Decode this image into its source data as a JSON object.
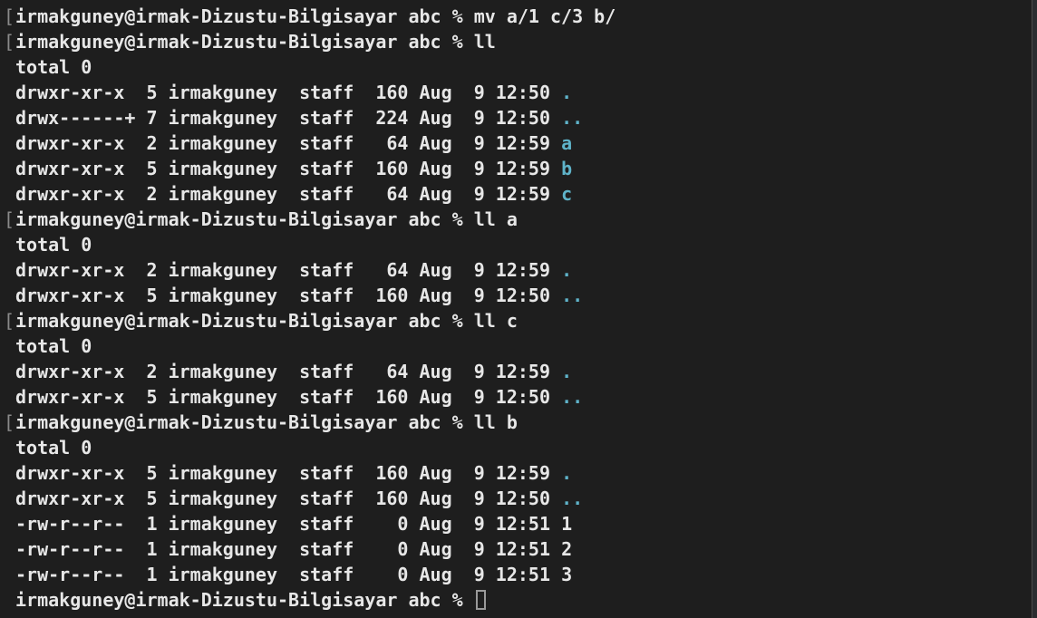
{
  "colors": {
    "background": "#1e1e1e",
    "foreground": "#e7e7e7",
    "directory_name": "#5fb3c9",
    "bracket": "#8a8a8a",
    "cursor": "#9a9a9a"
  },
  "terminal": {
    "lines": [
      {
        "type": "cmd",
        "text": "irmakguney@irmak-Dizustu-Bilgisayar abc % mv a/1 c/3 b/",
        "bracket_left": "[",
        "bracket_right": ""
      },
      {
        "type": "cmd",
        "text": "irmakguney@irmak-Dizustu-Bilgisayar abc % ll",
        "bracket_left": "[",
        "bracket_right": "]"
      },
      {
        "type": "out",
        "text": "total 0"
      },
      {
        "type": "entry",
        "text": "drwxr-xr-x  5 irmakguney  staff  160 Aug  9 12:50 ",
        "name": ".",
        "dir": true
      },
      {
        "type": "entry",
        "text": "drwx------+ 7 irmakguney  staff  224 Aug  9 12:50 ",
        "name": "..",
        "dir": true
      },
      {
        "type": "entry",
        "text": "drwxr-xr-x  2 irmakguney  staff   64 Aug  9 12:59 ",
        "name": "a",
        "dir": true
      },
      {
        "type": "entry",
        "text": "drwxr-xr-x  5 irmakguney  staff  160 Aug  9 12:59 ",
        "name": "b",
        "dir": true
      },
      {
        "type": "entry",
        "text": "drwxr-xr-x  2 irmakguney  staff   64 Aug  9 12:59 ",
        "name": "c",
        "dir": true
      },
      {
        "type": "cmd",
        "text": "irmakguney@irmak-Dizustu-Bilgisayar abc % ll a",
        "bracket_left": "[",
        "bracket_right": "]"
      },
      {
        "type": "out",
        "text": "total 0"
      },
      {
        "type": "entry",
        "text": "drwxr-xr-x  2 irmakguney  staff   64 Aug  9 12:59 ",
        "name": ".",
        "dir": true
      },
      {
        "type": "entry",
        "text": "drwxr-xr-x  5 irmakguney  staff  160 Aug  9 12:50 ",
        "name": "..",
        "dir": true
      },
      {
        "type": "cmd",
        "text": "irmakguney@irmak-Dizustu-Bilgisayar abc % ll c",
        "bracket_left": "[",
        "bracket_right": "]"
      },
      {
        "type": "out",
        "text": "total 0"
      },
      {
        "type": "entry",
        "text": "drwxr-xr-x  2 irmakguney  staff   64 Aug  9 12:59 ",
        "name": ".",
        "dir": true
      },
      {
        "type": "entry",
        "text": "drwxr-xr-x  5 irmakguney  staff  160 Aug  9 12:50 ",
        "name": "..",
        "dir": true
      },
      {
        "type": "cmd",
        "text": "irmakguney@irmak-Dizustu-Bilgisayar abc % ll b",
        "bracket_left": "[",
        "bracket_right": "]"
      },
      {
        "type": "out",
        "text": "total 0"
      },
      {
        "type": "entry",
        "text": "drwxr-xr-x  5 irmakguney  staff  160 Aug  9 12:59 ",
        "name": ".",
        "dir": true
      },
      {
        "type": "entry",
        "text": "drwxr-xr-x  5 irmakguney  staff  160 Aug  9 12:50 ",
        "name": "..",
        "dir": true
      },
      {
        "type": "entry",
        "text": "-rw-r--r--  1 irmakguney  staff    0 Aug  9 12:51 ",
        "name": "1",
        "dir": false
      },
      {
        "type": "entry",
        "text": "-rw-r--r--  1 irmakguney  staff    0 Aug  9 12:51 ",
        "name": "2",
        "dir": false
      },
      {
        "type": "entry",
        "text": "-rw-r--r--  1 irmakguney  staff    0 Aug  9 12:51 ",
        "name": "3",
        "dir": false
      },
      {
        "type": "prompt",
        "text": "irmakguney@irmak-Dizustu-Bilgisayar abc % "
      }
    ]
  }
}
